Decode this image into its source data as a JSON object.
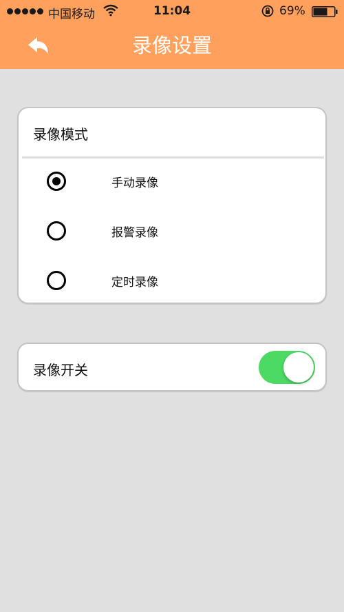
{
  "status_bar": {
    "carrier": "中国移动",
    "time": "11:04",
    "battery_percent": "69%",
    "battery_level": 0.69,
    "icons": [
      "signal-dots-icon",
      "wifi-icon",
      "rotation-lock-icon",
      "battery-icon"
    ]
  },
  "nav": {
    "title": "录像设置",
    "back_icon": "back-arrow-icon"
  },
  "record_mode": {
    "title": "录像模式",
    "options": [
      {
        "label": "手动录像",
        "selected": true
      },
      {
        "label": "报警录像",
        "selected": false
      },
      {
        "label": "定时录像",
        "selected": false
      }
    ]
  },
  "record_switch": {
    "label": "录像开关",
    "on": true
  },
  "colors": {
    "header_orange": "#ffa05c",
    "background": "#e0e0e0",
    "toggle_green": "#4cd964",
    "title_white": "#ffffff"
  }
}
